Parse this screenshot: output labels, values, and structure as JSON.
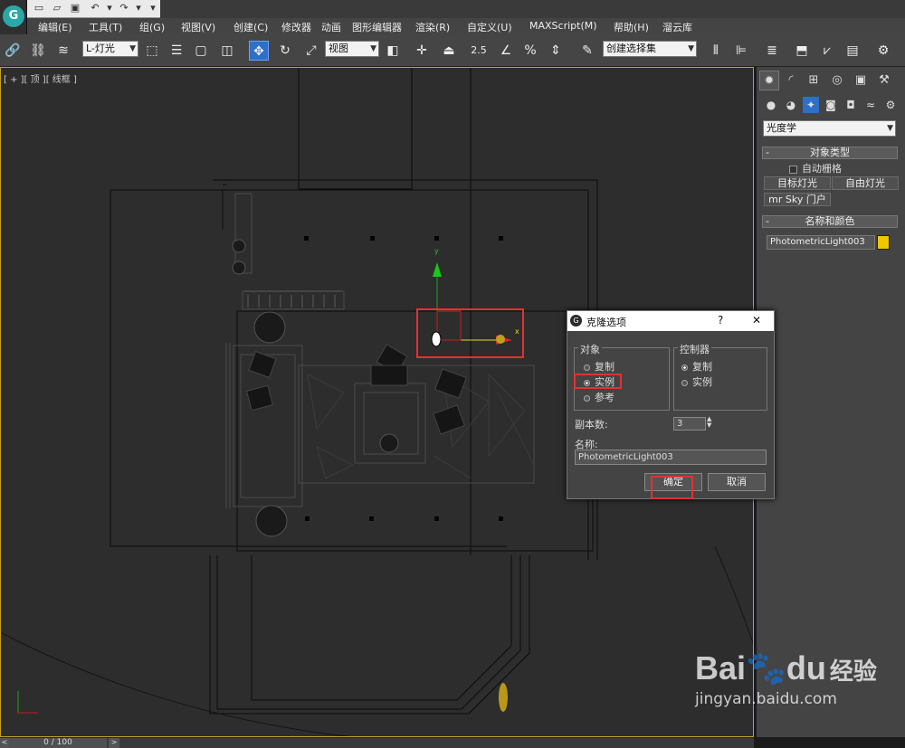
{
  "app": {
    "icon_letter": "G",
    "menu": [
      "编辑(E)",
      "工具(T)",
      "组(G)",
      "视图(V)",
      "创建(C)",
      "修改器",
      "动画",
      "图形编辑器",
      "渲染(R)",
      "自定义(U)",
      "MAXScript(M)",
      "帮助(H)",
      "溜云库"
    ]
  },
  "toolbar": {
    "filter_value": "L-灯光",
    "refcoord_value": "视图",
    "selection_set_value": "创建选择集",
    "snap_label": "2.5"
  },
  "viewport": {
    "label": "[ + ][ 顶 ][ 线框 ]",
    "gizmo_y": "y",
    "gizmo_x": "x"
  },
  "panel": {
    "category_value": "光度学",
    "rollout_object_type": "对象类型",
    "autogrid_label": "自动栅格",
    "btn_target_light": "目标灯光",
    "btn_free_light": "自由灯光",
    "btn_mr_sky": "mr Sky 门户",
    "rollout_name_color": "名称和颜色",
    "object_name": "PhotometricLight003",
    "object_color": "#f0c800",
    "collapse_symbol": "-"
  },
  "dialog": {
    "title": "克隆选项",
    "help": "?",
    "close": "✕",
    "group_object": "对象",
    "opt_copy": "复制",
    "opt_instance": "实例",
    "opt_reference": "参考",
    "selected_object": "实例",
    "group_controller": "控制器",
    "ctrl_copy": "复制",
    "ctrl_instance": "实例",
    "copies_label": "副本数:",
    "copies_value": "3",
    "name_label": "名称:",
    "name_value": "PhotometricLight003",
    "ok": "确定",
    "cancel": "取消"
  },
  "timeline": {
    "frame": "0 / 100",
    "prev": "<",
    "next": ">"
  },
  "watermark": {
    "brand": "Bai",
    "brand2": "du",
    "suffix": "经验",
    "url": "jingyan.baidu.com"
  },
  "colors": {
    "accent_blue": "#2e6fc8",
    "highlight_red": "#e53030",
    "viewport_border": "#c8a020"
  }
}
